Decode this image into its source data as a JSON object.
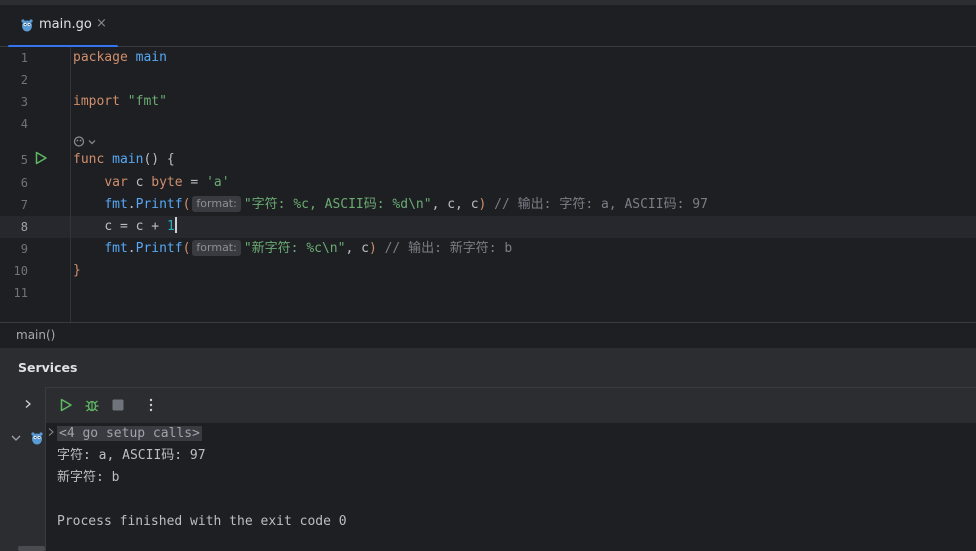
{
  "tab": {
    "label": "main.go",
    "close": "×"
  },
  "editor": {
    "line_numbers": [
      "1",
      "2",
      "3",
      "4",
      "5",
      "6",
      "7",
      "8",
      "9",
      "10",
      "11"
    ],
    "line1": {
      "kw": "package",
      "name": "main"
    },
    "line3": {
      "kw": "import",
      "str": "\"fmt\""
    },
    "line5": {
      "kw": "func",
      "fn": "main",
      "rest": "() {"
    },
    "line6": {
      "kw": "var",
      "name": " c ",
      "type": "byte",
      "eq": " = ",
      "str": "'a'"
    },
    "line7": {
      "pkg": "fmt",
      "dot": ".",
      "fn": "Printf",
      "open": "(",
      "hint": "format:",
      "str": "\"字符: %c, ASCII码: %d\\n\"",
      "args": ", c, c",
      "close": ")",
      "comment": " // 输出: 字符: a, ASCII码: 97"
    },
    "line8": {
      "code": "c = c + ",
      "num": "1"
    },
    "line9": {
      "pkg": "fmt",
      "dot": ".",
      "fn": "Printf",
      "open": "(",
      "hint": "format:",
      "str": "\"新字符: %c\\n\"",
      "args": ", c",
      "close": ")",
      "comment": " // 输出: 新字符: b"
    },
    "line10": {
      "code": "}"
    }
  },
  "breadcrumb": "main()",
  "services": {
    "title": "Services",
    "console": {
      "folded": "<4 go setup calls>",
      "out1": "字符: a, ASCII码: 97",
      "out2": "新字符: b",
      "exit": "Process finished with the exit code 0"
    }
  },
  "colors": {
    "accent": "#3574f0",
    "keyword": "#cf8e6d",
    "function": "#56a8f5",
    "string": "#6aab73",
    "number": "#2aacb8",
    "comment": "#7a7e85",
    "run": "#5fb865"
  }
}
